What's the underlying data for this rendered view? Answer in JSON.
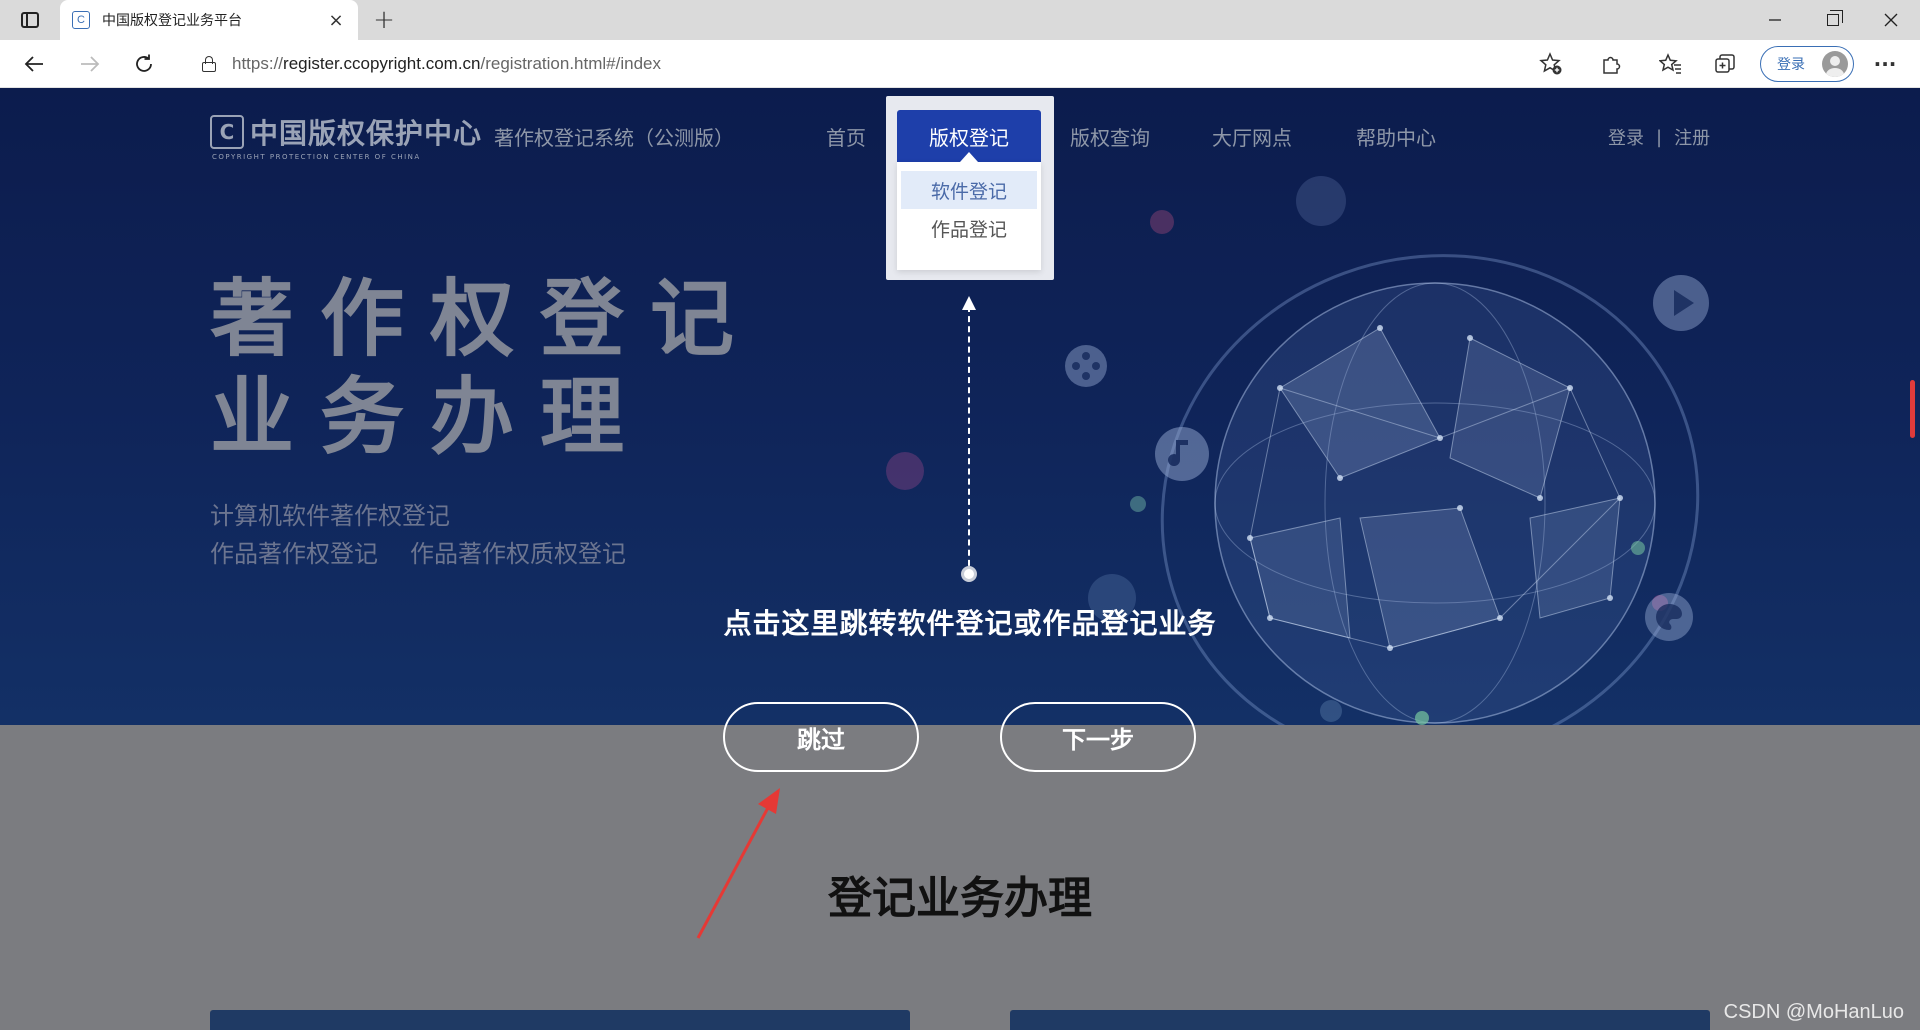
{
  "browser": {
    "tab_title": "中国版权登记业务平台",
    "tab_favicon": "C",
    "tab_close": "×",
    "new_tab": "+",
    "url_prefix": "https://",
    "url_host": "register.ccopyright.com.cn",
    "url_path": "/registration.html#/index",
    "profile_label": "登录",
    "more": "···"
  },
  "site": {
    "logo_cn": "中国版权保护中心",
    "logo_en": "COPYRIGHT PROTECTION CENTER OF CHINA",
    "logo_mark": "C",
    "system_name": "著作权登记系统（公测版）",
    "nav": {
      "home": "首页",
      "register": "版权登记",
      "query": "版权查询",
      "hall": "大厅网点",
      "help": "帮助中心"
    },
    "dropdown": [
      "软件登记",
      "作品登记"
    ],
    "login": "登录",
    "separator": "|",
    "signup": "注册"
  },
  "hero": {
    "title_line1": "著作权登记",
    "title_line2": "业务办理",
    "sub_line1": "计算机软件著作权登记",
    "sub_line2a": "作品著作权登记",
    "sub_line2b": "作品著作权质权登记"
  },
  "guide": {
    "text": "点击这里跳转软件登记或作品登记业务",
    "skip_label": "跳过",
    "next_label": "下一步"
  },
  "section": {
    "title": "登记业务办理"
  },
  "watermark": "CSDN @MoHanLuo",
  "colors": {
    "hero_top": "#0c1c4d",
    "nav_active": "#1e3faa",
    "overlay_grey": "#7b7c80",
    "arrow_red": "#e53935"
  }
}
